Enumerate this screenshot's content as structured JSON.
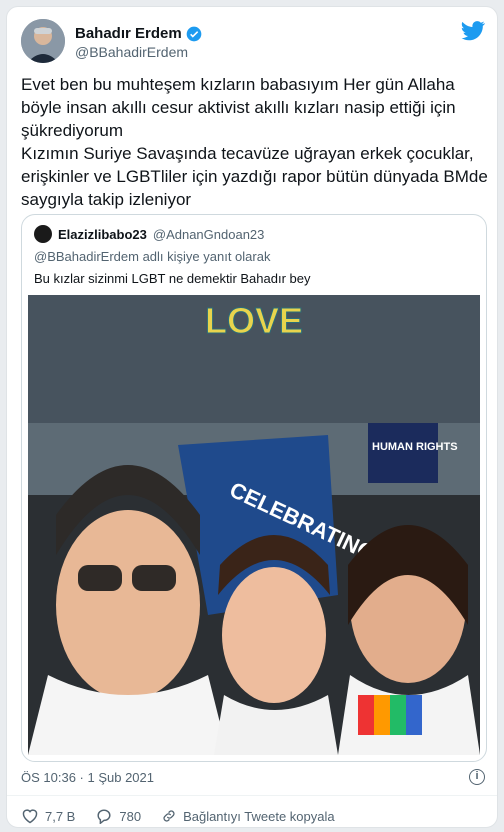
{
  "author": {
    "name": "Bahadır Erdem",
    "handle": "@BBahadirErdem"
  },
  "tweet": {
    "lines": [
      "Evet ben bu muhteşem kızların babasıyım Her gün Allaha böyle insan akıllı cesur aktivist akıllı kızları nasip ettiği için şükrediyorum",
      "Kızımın Suriye Savaşında tecavüze uğrayan erkek çocuklar, erişkinler ve LGBTliler  için yazdığı rapor bütün dünyada BMde saygıyla takip izleniyor"
    ]
  },
  "quote": {
    "name": "Elazizlibabo23",
    "handle": "@AdnanGndoan23",
    "reply_context": "@BBahadirErdem adlı kişiye yanıt olarak",
    "text": "Bu kızlar sizinmi LGBT ne demektir Bahadır bey",
    "image": {
      "banner_text": "LOVE",
      "sign_text": "CELEBRATING PRIDE",
      "sign_right": "HUMAN RIGHTS"
    }
  },
  "timestamp": "ÖS 10:36 · 1 Şub 2021",
  "actions": {
    "likes": "7,7 B",
    "replies": "780",
    "copy_link": "Bağlantıyı Tweete kopyala"
  }
}
